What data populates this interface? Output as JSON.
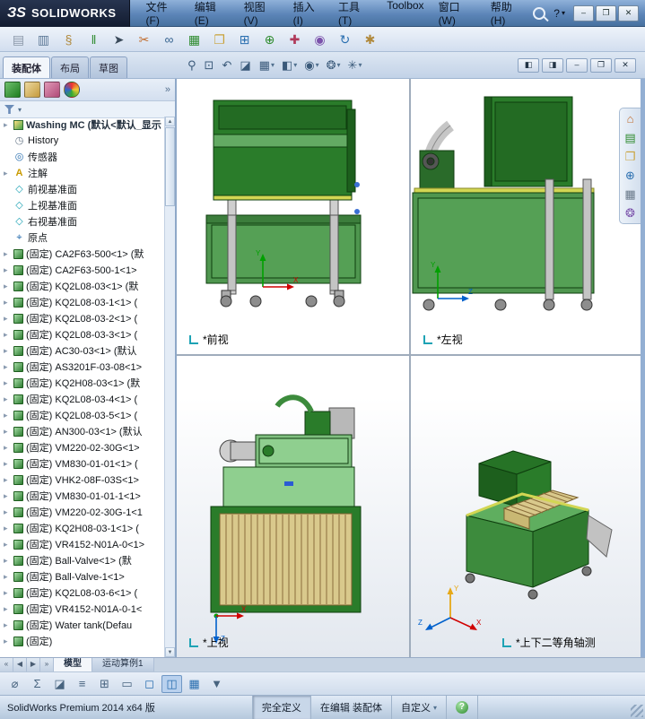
{
  "titlebar": {
    "logo": "ЗS",
    "brand": "SOLIDWORKS",
    "menu": [
      "文件(F)",
      "编辑(E)",
      "视图(V)",
      "插入(I)",
      "工具(T)",
      "Toolbox",
      "窗口(W)",
      "帮助(H)"
    ],
    "help": "?",
    "buttons": [
      {
        "name": "minimize-button",
        "glyph": "–"
      },
      {
        "name": "maximize-button",
        "glyph": "❐"
      },
      {
        "name": "close-button",
        "glyph": "✕"
      }
    ]
  },
  "glyphs": {
    "expand": "▸",
    "up": "▲",
    "down": "▼",
    "dd": "▾",
    "chevron": "»",
    "history": "◷",
    "sensors": "◎",
    "annotations": "A",
    "plane": "◇",
    "origin": "⌖"
  },
  "axes": {
    "x": "X",
    "y": "Y",
    "z": "Z"
  },
  "toolbar_main": {
    "icons": [
      {
        "name": "paste-icon",
        "glyph": "▤",
        "color": "#8a97a8"
      },
      {
        "name": "print-icon",
        "glyph": "▥",
        "color": "#5b7795"
      },
      {
        "name": "paperclip-icon",
        "glyph": "§",
        "color": "#b0893c"
      },
      {
        "name": "rebuild-icon",
        "glyph": "‖",
        "color": "#2e8b2e"
      },
      {
        "name": "select-arrow-icon",
        "glyph": "➤",
        "color": "#3a4a5a"
      },
      {
        "name": "trim-icon",
        "glyph": "✂",
        "color": "#c06a2a"
      },
      {
        "name": "spectacles-icon",
        "glyph": "∞",
        "color": "#36638f"
      },
      {
        "name": "table-edit-icon",
        "glyph": "▦",
        "color": "#2e8b2e"
      },
      {
        "name": "open-folder-icon",
        "glyph": "❐",
        "color": "#c9a23a"
      },
      {
        "name": "mate-icon",
        "glyph": "⊞",
        "color": "#2a6fb0"
      },
      {
        "name": "insert-component-icon",
        "glyph": "⊕",
        "color": "#2e8b2e"
      },
      {
        "name": "fastener-icon",
        "glyph": "✚",
        "color": "#b03a5a"
      },
      {
        "name": "appearance-icon",
        "glyph": "◉",
        "color": "#7b52ab"
      },
      {
        "name": "rotate-view-icon",
        "glyph": "↻",
        "color": "#2a6fb0"
      },
      {
        "name": "options-icon",
        "glyph": "✱",
        "color": "#b0893c"
      }
    ]
  },
  "view_toolbar": {
    "icons": [
      {
        "name": "zoom-icon",
        "glyph": "⚲",
        "arrow": ""
      },
      {
        "name": "zoom-area-icon",
        "glyph": "⊡",
        "arrow": ""
      },
      {
        "name": "previous-view-icon",
        "glyph": "↶",
        "arrow": ""
      },
      {
        "name": "section-view-icon",
        "glyph": "◪",
        "arrow": ""
      },
      {
        "name": "view-orientation-icon",
        "glyph": "▦",
        "arrow": "▾"
      },
      {
        "name": "display-style-icon",
        "glyph": "◧",
        "arrow": "▾"
      },
      {
        "name": "hide-show-icon",
        "glyph": "◉",
        "arrow": "▾"
      },
      {
        "name": "appearances-icon",
        "glyph": "❂",
        "arrow": "▾"
      },
      {
        "name": "scene-icon",
        "glyph": "✳",
        "arrow": "▾"
      }
    ]
  },
  "panel_tabs": [
    "装配体",
    "布局",
    "草图"
  ],
  "tree": {
    "root": "Washing MC (默认<默认_显示",
    "history": "History",
    "sensors": "传感器",
    "annotations": "注解",
    "plane_front": "前视基准面",
    "plane_top": "上视基准面",
    "plane_right": "右视基准面",
    "origin": "原点",
    "components": [
      "(固定) CA2F63-500<1> (默",
      "(固定) CA2F63-500-1<1>",
      "(固定) KQ2L08-03<1> (默",
      "(固定) KQ2L08-03-1<1> (",
      "(固定) KQ2L08-03-2<1> (",
      "(固定) KQ2L08-03-3<1> (",
      "(固定) AC30-03<1> (默认",
      "(固定) AS3201F-03-08<1>",
      "(固定) KQ2H08-03<1> (默",
      "(固定) KQ2L08-03-4<1> (",
      "(固定) KQ2L08-03-5<1> (",
      "(固定) AN300-03<1> (默认",
      "(固定) VM220-02-30G<1>",
      "(固定) VM830-01-01<1> (",
      "(固定) VHK2-08F-03S<1>",
      "(固定) VM830-01-01-1<1>",
      "(固定) VM220-02-30G-1<1",
      "(固定) KQ2H08-03-1<1> (",
      "(固定) VR4152-N01A-0<1>",
      "(固定) Ball-Valve<1> (默",
      "(固定) Ball-Valve-1<1>",
      "(固定) KQ2L08-03-6<1> (",
      "(固定) VR4152-N01A-0-1<",
      "(固定) Water tank(Defau",
      "(固定)"
    ]
  },
  "viewport": {
    "labels": [
      "*前视",
      "*左视",
      "*上视",
      "*上下二等角轴测"
    ],
    "doc_controls": [
      {
        "name": "window-tile-left-icon",
        "glyph": "◧"
      },
      {
        "name": "window-tile-right-icon",
        "glyph": "◨"
      },
      {
        "name": "minimize-doc-button",
        "glyph": "–"
      },
      {
        "name": "restore-doc-button",
        "glyph": "❐"
      },
      {
        "name": "close-doc-button",
        "glyph": "✕"
      }
    ]
  },
  "task_pane": {
    "icons": [
      {
        "name": "home-icon",
        "glyph": "⌂",
        "color": "#c06a2a"
      },
      {
        "name": "design-library-icon",
        "glyph": "▤",
        "color": "#2e8b2e"
      },
      {
        "name": "file-explorer-icon",
        "glyph": "❐",
        "color": "#c9a23a"
      },
      {
        "name": "forum-icon",
        "glyph": "⊕",
        "color": "#2a6fb0"
      },
      {
        "name": "view-palette-icon",
        "glyph": "▦",
        "color": "#6a7a8a"
      },
      {
        "name": "appearances-pane-icon",
        "glyph": "❂",
        "color": "#7b52ab"
      }
    ]
  },
  "bottom": {
    "nav": [
      "«",
      "◀",
      "▶",
      "»"
    ],
    "tabs": [
      "模型",
      "运动算例1"
    ],
    "toolbar": [
      {
        "name": "measure-icon",
        "glyph": "⌀",
        "color": "#48647f"
      },
      {
        "name": "mass-properties-icon",
        "glyph": "Σ",
        "color": "#48647f"
      },
      {
        "name": "section-properties-icon",
        "glyph": "◪",
        "color": "#48647f"
      },
      {
        "name": "list-icon",
        "glyph": "≡",
        "color": "#48647f"
      },
      {
        "name": "grid-icon",
        "glyph": "⊞",
        "color": "#48647f"
      },
      {
        "name": "ruler-icon",
        "glyph": "▭",
        "color": "#48647f"
      },
      {
        "name": "single-pane-icon",
        "glyph": "◻",
        "color": "#2a6fb0"
      },
      {
        "name": "split-pane-icon",
        "glyph": "◫",
        "color": "#2a6fb0",
        "active": true
      },
      {
        "name": "viewport-grid-icon",
        "glyph": "▦",
        "color": "#2a6fb0"
      },
      {
        "name": "save-table-icon",
        "glyph": "▼",
        "color": "#48647f"
      }
    ]
  },
  "statusbar": {
    "product": "SolidWorks Premium 2014 x64 版",
    "definition": "完全定义",
    "editing": "在编辑 装配体",
    "custom": "自定义",
    "help": "?"
  }
}
